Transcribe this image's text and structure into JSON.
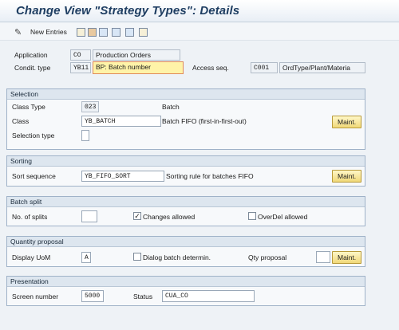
{
  "title": "Change View \"Strategy Types\": Details",
  "toolbar": {
    "new_entries": "New Entries"
  },
  "header": {
    "application_label": "Application",
    "application_code": "CO",
    "application_desc": "Production Orders",
    "condit_label": "Condit. type",
    "condit_code": "YB11",
    "condit_desc": "BP: Batch number",
    "access_label": "Access seq.",
    "access_code": "C001",
    "access_desc": "OrdType/Plant/Materia"
  },
  "selection": {
    "title": "Selection",
    "class_type_label": "Class Type",
    "class_type_value": "023",
    "class_type_desc": "Batch",
    "class_label": "Class",
    "class_value": "YB_BATCH",
    "class_desc": "Batch FIFO (first-in-first-out)",
    "selection_type_label": "Selection type",
    "selection_type_value": "",
    "maint_label": "Maint."
  },
  "sorting": {
    "title": "Sorting",
    "sort_label": "Sort sequence",
    "sort_value": "YB_FIFO_SORT",
    "sort_desc": "Sorting rule for batches FIFO",
    "maint_label": "Maint."
  },
  "batch_split": {
    "title": "Batch split",
    "splits_label": "No. of splits",
    "splits_value": "",
    "changes_label": "Changes allowed",
    "changes_checked": true,
    "overdel_label": "OverDel allowed",
    "overdel_checked": false
  },
  "quantity": {
    "title": "Quantity proposal",
    "uom_label": "Display UoM",
    "uom_value": "A",
    "dialog_label": "Dialog batch determin.",
    "dialog_checked": false,
    "qty_label": "Qty proposal",
    "qty_value": "",
    "maint_label": "Maint."
  },
  "presentation": {
    "title": "Presentation",
    "screen_label": "Screen number",
    "screen_value": "5000",
    "status_label": "Status",
    "status_value": "CUA_CO"
  },
  "colors": {
    "title": "#1f3e62",
    "highlight": "#fff3a8",
    "button": "#f0d878"
  }
}
